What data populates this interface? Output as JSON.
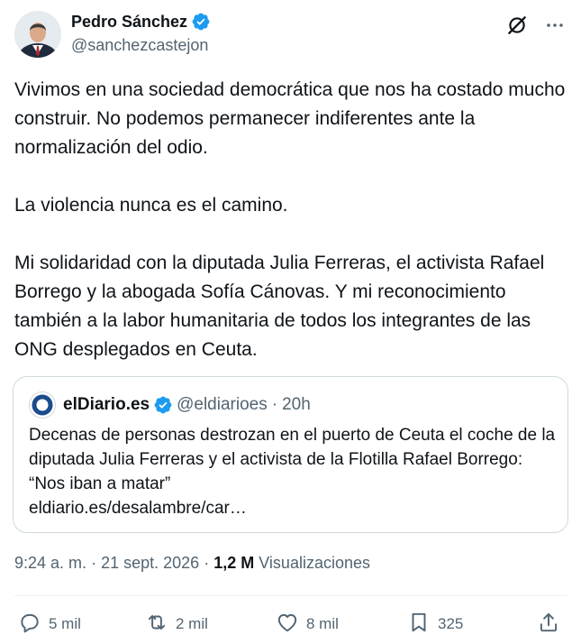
{
  "author": {
    "name": "Pedro Sánchez",
    "handle": "@sanchezcastejon",
    "verified": true
  },
  "header_actions": [
    "grok-icon",
    "more-icon"
  ],
  "tweet": {
    "paragraphs": [
      "Vivimos en una sociedad democrática que nos ha costado mucho construir. No podemos permanecer indiferentes ante la normalización del odio.",
      "La violencia nunca es el camino.",
      "Mi solidaridad con la diputada Julia Ferreras, el activista Rafael Borrego y la abogada Sofía Cánovas. Y mi reconocimiento también a la labor humanitaria de todos los integrantes de las ONG desplegados en Ceuta."
    ]
  },
  "quote": {
    "name": "elDiario.es",
    "handle": "@eldiarioes",
    "separator": "·",
    "time": "20h",
    "text": "Decenas de personas destrozan en el puerto de Ceuta el coche de la diputada Julia Ferreras y el activista de la Flotilla Rafael Borrego: “Nos iban a matar”",
    "link": "eldiario.es/desalambre/car…"
  },
  "meta": {
    "time": "9:24 a. m.",
    "separator": "·",
    "date": "21 sept. 2026",
    "views_count": "1,2 M",
    "views_label": "Visualizaciones"
  },
  "actions": {
    "replies": "5 mil",
    "reposts": "2 mil",
    "likes": "8 mil",
    "bookmarks": "325"
  },
  "colors": {
    "text": "#0f1419",
    "secondary": "#536471",
    "verified": "#1d9bf0",
    "border": "#cfd9de",
    "brand_eldiario": "#1a4b8c"
  }
}
